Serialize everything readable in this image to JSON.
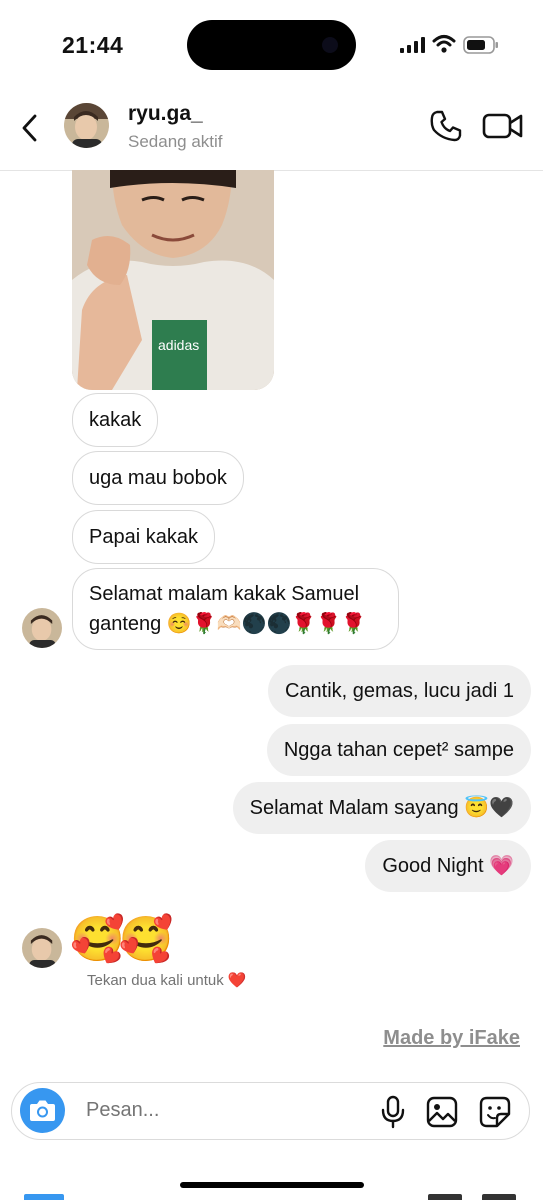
{
  "status_bar": {
    "time": "21:44"
  },
  "header": {
    "name": "ryu.ga_",
    "status": "Sedang aktif"
  },
  "messages": {
    "incoming": [
      {
        "text": "kakak"
      },
      {
        "text": "uga mau bobok"
      },
      {
        "text": "Papai kakak"
      },
      {
        "text": "Selamat malam kakak Samuel ganteng ☺️🌹🫶🏻🌑🌑🌹🌹🌹"
      }
    ],
    "outgoing": [
      {
        "text": "Cantik, gemas, lucu jadi 1"
      },
      {
        "text": "Ngga tahan cepet² sampe"
      },
      {
        "text": "Selamat Malam sayang 😇🖤"
      },
      {
        "text": "Good Night 💗"
      }
    ],
    "emoji_message": "🥰🥰",
    "reaction_hint": "Tekan dua kali untuk ❤️"
  },
  "watermark": "Made by iFake",
  "composer": {
    "placeholder": "Pesan..."
  },
  "colors": {
    "accent": "#3797f0",
    "outgoing_bubble": "#efefef",
    "muted_text": "#8e8e8e"
  }
}
